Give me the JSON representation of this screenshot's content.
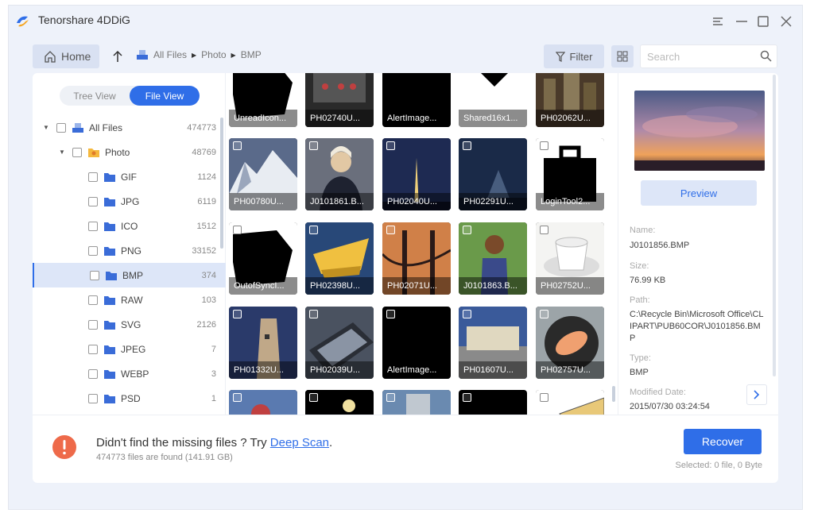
{
  "app": {
    "title": "Tenorshare 4DDiG"
  },
  "toolbar": {
    "home_label": "Home",
    "breadcrumb": [
      "All Files",
      "Photo",
      "BMP"
    ],
    "filter_label": "Filter",
    "search_placeholder": "Search"
  },
  "view_toggle": {
    "tree": "Tree View",
    "file": "File View",
    "active": "File View"
  },
  "tree": [
    {
      "label": "All Files",
      "count": "474773",
      "level": 0,
      "icon": "drive-icon"
    },
    {
      "label": "Photo",
      "count": "48769",
      "level": 1,
      "icon": "photo-folder-icon"
    },
    {
      "label": "GIF",
      "count": "1124",
      "level": 2,
      "icon": "folder-icon"
    },
    {
      "label": "JPG",
      "count": "6119",
      "level": 2,
      "icon": "folder-icon"
    },
    {
      "label": "ICO",
      "count": "1512",
      "level": 2,
      "icon": "folder-icon"
    },
    {
      "label": "PNG",
      "count": "33152",
      "level": 2,
      "icon": "folder-icon"
    },
    {
      "label": "BMP",
      "count": "374",
      "level": 2,
      "icon": "folder-icon",
      "selected": true
    },
    {
      "label": "RAW",
      "count": "103",
      "level": 2,
      "icon": "folder-icon"
    },
    {
      "label": "SVG",
      "count": "2126",
      "level": 2,
      "icon": "folder-icon"
    },
    {
      "label": "JPEG",
      "count": "7",
      "level": 2,
      "icon": "folder-icon"
    },
    {
      "label": "WEBP",
      "count": "3",
      "level": 2,
      "icon": "folder-icon"
    },
    {
      "label": "PSD",
      "count": "1",
      "level": 2,
      "icon": "folder-icon"
    }
  ],
  "files": [
    [
      "UnreadIcon...",
      "PH02740U...",
      "AlertImage...",
      "Shared16x1...",
      "PH02062U..."
    ],
    [
      "PH00780U...",
      "J0101861.B...",
      "PH02040U...",
      "PH02291U...",
      "LoginTool2..."
    ],
    [
      "OutofSyncI...",
      "PH02398U...",
      "PH02071U...",
      "J0101863.B...",
      "PH02752U..."
    ],
    [
      "PH01332U...",
      "PH02039U...",
      "AlertImage...",
      "PH01607U...",
      "PH02757U..."
    ],
    [
      "",
      "",
      "",
      "",
      ""
    ]
  ],
  "details": {
    "preview_label": "Preview",
    "name_label": "Name:",
    "name": "J0101856.BMP",
    "size_label": "Size:",
    "size": "76.99 KB",
    "path_label": "Path:",
    "path": "C:\\Recycle Bin\\Microsoft Office\\CLIPART\\PUB60COR\\J0101856.BMP",
    "type_label": "Type:",
    "type": "BMP",
    "modified_label": "Modified Date:",
    "modified": "2015/07/30 03:24:54"
  },
  "bottom": {
    "msg_prefix": "Didn't find the missing files ? Try ",
    "deep_scan": "Deep Scan",
    "msg_suffix": ".",
    "sub": "474773 files are found (141.91 GB)",
    "recover_label": "Recover",
    "selected_info": "Selected: 0 file, 0 Byte"
  },
  "colors": {
    "accent": "#2f6ee8",
    "warning": "#ee6a4a"
  }
}
